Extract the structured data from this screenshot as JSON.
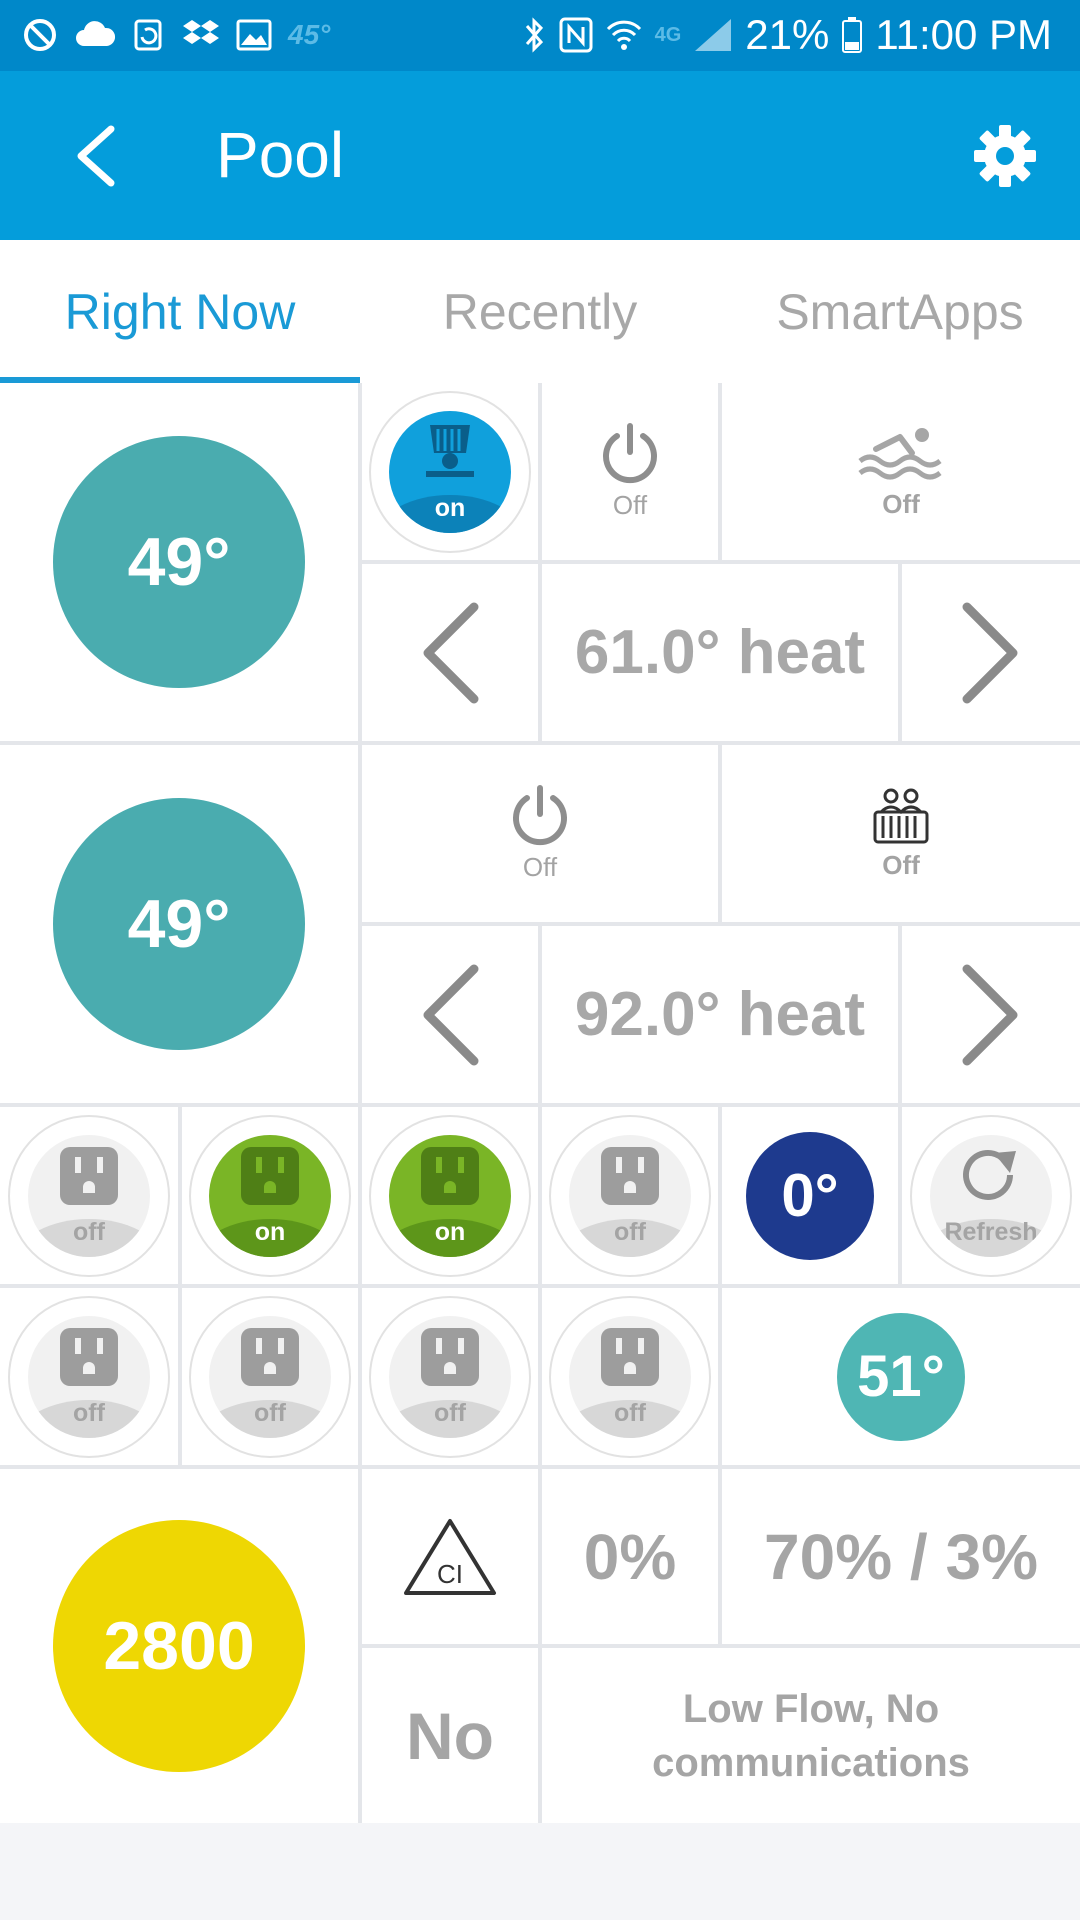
{
  "status_bar": {
    "weather_temp": "45°",
    "network": "4G",
    "battery": "21%",
    "time": "11:00 PM"
  },
  "app_bar": {
    "title": "Pool"
  },
  "tabs": [
    {
      "label": "Right Now",
      "active": true
    },
    {
      "label": "Recently",
      "active": false
    },
    {
      "label": "SmartApps",
      "active": false
    }
  ],
  "pool": {
    "temperature": "49°",
    "light": {
      "label": "on",
      "state": "on"
    },
    "power": {
      "label": "Off"
    },
    "pool_mode": {
      "label": "Off"
    },
    "setpoint": "61.0° heat"
  },
  "spa": {
    "temperature": "49°",
    "power": {
      "label": "Off"
    },
    "spa_mode": {
      "label": "Off"
    },
    "setpoint": "92.0° heat"
  },
  "outlets_row1": [
    {
      "label": "off",
      "state": "off"
    },
    {
      "label": "on",
      "state": "on"
    },
    {
      "label": "on",
      "state": "on"
    },
    {
      "label": "off",
      "state": "off"
    }
  ],
  "air_temp": "0°",
  "refresh": {
    "label": "Refresh"
  },
  "outlets_row2": [
    {
      "label": "off",
      "state": "off"
    },
    {
      "label": "off",
      "state": "off"
    },
    {
      "label": "off",
      "state": "off"
    },
    {
      "label": "off",
      "state": "off"
    }
  ],
  "water_temp": "51°",
  "chlorinator": {
    "salt": "2800",
    "percent": "0%",
    "output": "70% / 3%",
    "super_chlorinate": "No",
    "status": "Low Flow, No communications",
    "icon_text": "CI"
  },
  "colors": {
    "header": "#049ddb",
    "accent": "#1a9ad6",
    "teal": "#4aacaf",
    "yellow": "#eed703",
    "green": "#7ab526",
    "navy": "#1e3a8e"
  }
}
